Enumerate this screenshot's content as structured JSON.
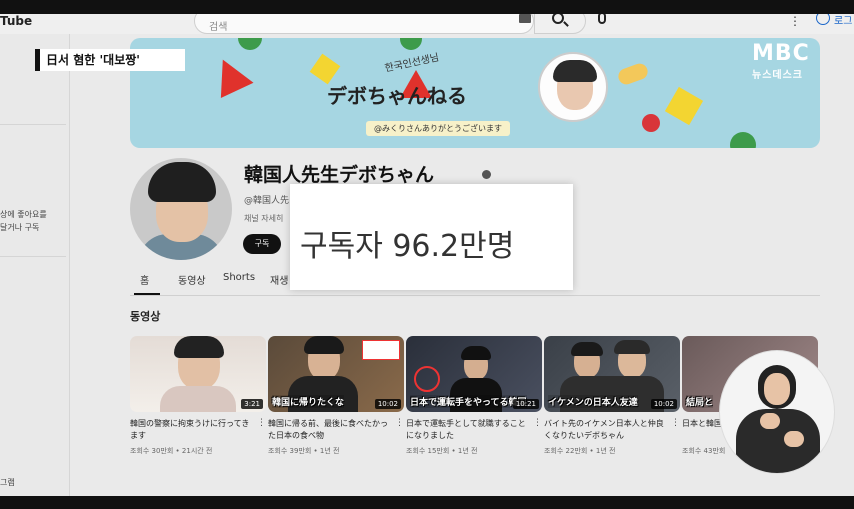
{
  "youtube": {
    "logo": "Tube",
    "search_placeholder": "검색",
    "signin_label": "로그"
  },
  "sidebar": {
    "texts": [
      "상에 좋아요를",
      "달거나 구독",
      "그램"
    ]
  },
  "banner": {
    "subtitle": "한국인선생님",
    "title": "デボちゃんねる",
    "tag": "@みくりさんありがとうございます"
  },
  "channel": {
    "name": "韓国人先生デボちゃん",
    "handle": "@韓国人先",
    "description": "채널 자세히",
    "subscribe_label": "구독"
  },
  "tabs": [
    "홈",
    "동영상",
    "Shorts",
    "재생"
  ],
  "section_title": "동영상",
  "videos": [
    {
      "caption": "",
      "duration": "3:21",
      "title": "韓国の警察に拘束うけに行ってきます",
      "meta": "조회수 30만회 • 21시간 전",
      "colors": [
        "#d9cfc8",
        "#f1ede8"
      ]
    },
    {
      "caption": "韓国に帰りたくな",
      "duration": "10:02",
      "title": "韓国に帰る前、最後に食べたかった日本の食べ物",
      "meta": "조회수 39만회 • 1년 전",
      "colors": [
        "#5a4a3a",
        "#8a6a4a"
      ]
    },
    {
      "caption": "日本で運転手をやってる韓国",
      "duration": "10:21",
      "title": "日本で運転手として就職することになりました",
      "meta": "조회수 15만회 • 1년 전",
      "colors": [
        "#2a2f3a",
        "#4a5060"
      ]
    },
    {
      "caption": "イケメンの日本人友達",
      "duration": "10:02",
      "title": "バイト先のイケメン日本人と仲良くなりたいデボちゃん",
      "meta": "조회수 22만회 • 1년 전",
      "colors": [
        "#3a4048",
        "#5a6068"
      ]
    },
    {
      "caption": "結局と",
      "duration": "",
      "title": "日本と韓国 やすい?",
      "meta": "조회수 43만회",
      "colors": [
        "#6a5a5a",
        "#a08888"
      ]
    }
  ],
  "overlay": {
    "headline": "日서 혐한 '대보짱'",
    "broadcaster": "MBC",
    "broadcaster_sub": "뉴스데스크",
    "subscriber_popup": "구독자 96.2만명"
  },
  "colors": {
    "banner_bg": "#a6d6e2",
    "page_bg": "#eaeaea",
    "subscribe_btn": "#111111"
  }
}
